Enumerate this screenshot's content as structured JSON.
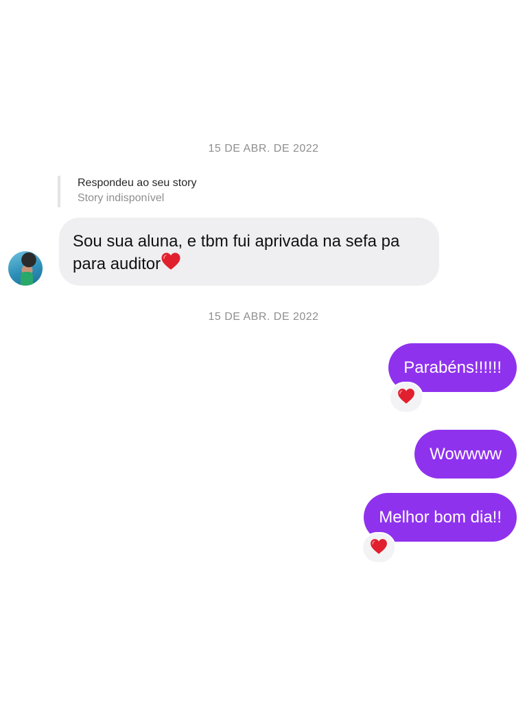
{
  "conversation": {
    "date_separators": [
      "15 DE ABR. DE 2022",
      "15 DE ABR. DE 2022"
    ],
    "story_reply": {
      "title": "Respondeu ao seu story",
      "subtitle": "Story indisponível"
    },
    "incoming_message": {
      "text": "Sou sua aluna, e tbm fui aprivada na sefa pa para auditor",
      "trailing_icon": "red-heart-icon"
    },
    "outgoing_messages": [
      {
        "text": "Parabéns!!!!!!",
        "reaction": "red-heart-icon"
      },
      {
        "text": "Wowwww",
        "reaction": ""
      },
      {
        "text": "Melhor bom dia!!",
        "reaction": "red-heart-icon"
      }
    ]
  },
  "colors": {
    "outgoing_bubble": "#8f32ee",
    "incoming_bubble": "#efeff1",
    "date_text": "#8e8e8e",
    "heart": "#e0202e"
  }
}
